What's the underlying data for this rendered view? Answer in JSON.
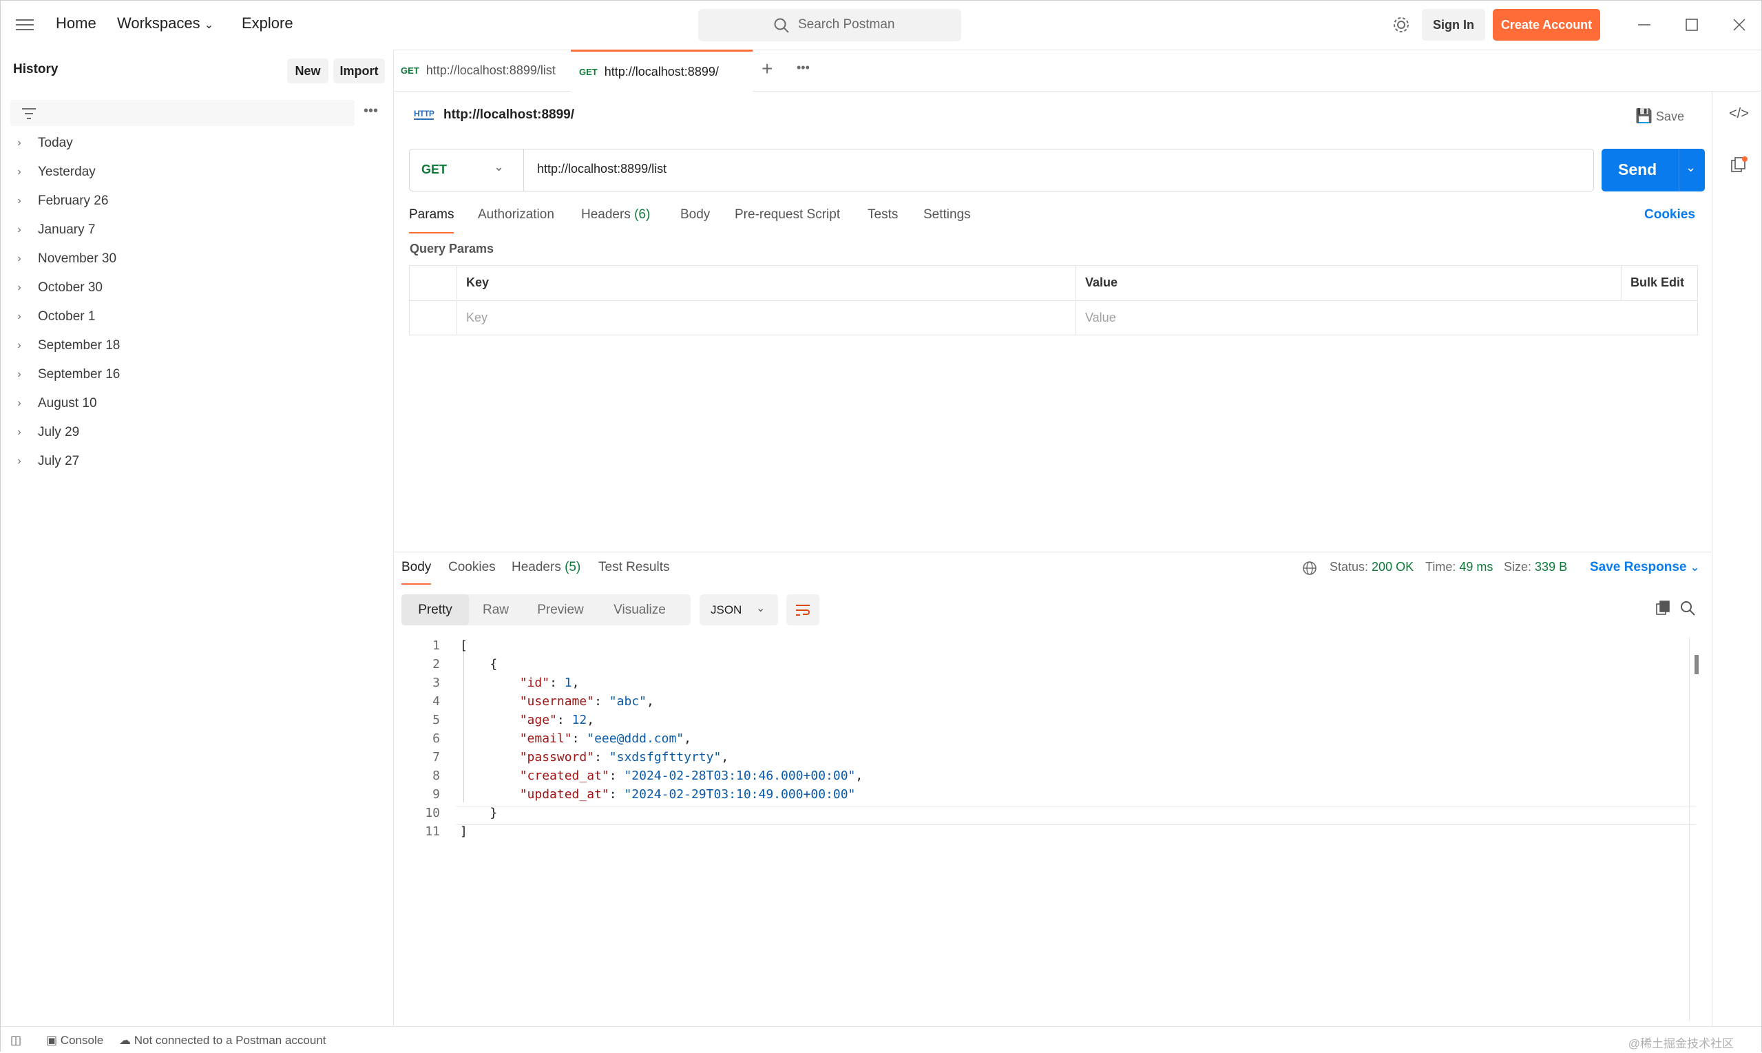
{
  "titlebar": {
    "nav": [
      "Home",
      "Workspaces",
      "Explore"
    ],
    "search_placeholder": "Search Postman",
    "sign_in": "Sign In",
    "create_account": "Create Account",
    "accent": "#ff6c37"
  },
  "sidebar": {
    "title": "History",
    "new_label": "New",
    "import_label": "Import",
    "items": [
      "Today",
      "Yesterday",
      "February 26",
      "January 7",
      "November 30",
      "October 30",
      "October 1",
      "September 18",
      "September 16",
      "August 10",
      "July 29",
      "July 27"
    ]
  },
  "tabs": [
    {
      "method": "GET",
      "label": "http://localhost:8899/list"
    },
    {
      "method": "GET",
      "label": "http://localhost:8899/"
    }
  ],
  "request": {
    "title": "http://localhost:8899/",
    "save_label": "Save",
    "method": "GET",
    "url": "http://localhost:8899/list",
    "send_label": "Send",
    "tabs": [
      "Params",
      "Authorization",
      "Headers",
      "Body",
      "Pre-request Script",
      "Tests",
      "Settings"
    ],
    "headers_count": "(6)",
    "cookies_label": "Cookies",
    "query_params_title": "Query Params",
    "table": {
      "key_header": "Key",
      "value_header": "Value",
      "bulk_edit": "Bulk Edit",
      "key_placeholder": "Key",
      "value_placeholder": "Value"
    }
  },
  "response": {
    "tabs": [
      "Body",
      "Cookies",
      "Headers",
      "Test Results"
    ],
    "headers_count": "(5)",
    "status_label": "Status:",
    "status_value": "200 OK",
    "time_label": "Time:",
    "time_value": "49 ms",
    "size_label": "Size:",
    "size_value": "339 B",
    "save_response": "Save Response",
    "view_modes": [
      "Pretty",
      "Raw",
      "Preview",
      "Visualize"
    ],
    "format": "JSON",
    "body": {
      "id": "1",
      "username": "\"abc\"",
      "age": "12",
      "email": "\"eee@ddd.com\"",
      "password": "\"sxdsfgfttyrty\"",
      "created_at": "\"2024-02-28T03:10:46.000+00:00\"",
      "updated_at": "\"2024-02-29T03:10:49.000+00:00\""
    }
  },
  "footer": {
    "console": "Console",
    "account_status": "Not connected to a Postman account",
    "watermark": "@稀土掘金技术社区"
  }
}
